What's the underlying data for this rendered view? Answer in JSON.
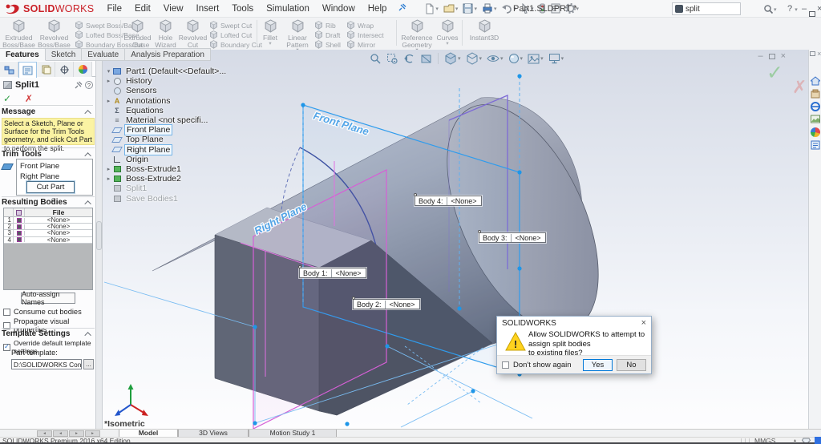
{
  "glyphs": {
    "dropdown": "▾",
    "expand": "▸",
    "expanded": "▾",
    "tab_prev": "◂",
    "tab_next": "▸",
    "close": "×",
    "minimize": "–",
    "help": "?",
    "ok_check": "✓",
    "cancel_x": "✗",
    "ellipsis": "...",
    "annotation": "A",
    "equations": "Σ",
    "material": "≡",
    "exclaim": "!",
    "units_arrow": "▴",
    "check": "✓"
  },
  "titlebar": {
    "logo_bold": "SOLID",
    "logo_light": "WORKS",
    "menus": [
      "File",
      "Edit",
      "View",
      "Insert",
      "Tools",
      "Simulation",
      "Window",
      "Help"
    ],
    "title": "Part1.SLDPRT *",
    "search_value": "split"
  },
  "ribbon": {
    "groups": [
      {
        "buttons": [
          {
            "label": "Extruded Boss/Base"
          },
          {
            "label": "Revolved Boss/Base"
          }
        ],
        "stack": [
          {
            "label": "Swept Boss/Base"
          },
          {
            "label": "Lofted Boss/Base"
          },
          {
            "label": "Boundary Boss/Base"
          }
        ]
      },
      {
        "buttons": [
          {
            "label": "Extruded Cut"
          },
          {
            "label": "Hole Wizard"
          },
          {
            "label": "Revolved Cut"
          }
        ],
        "stack": [
          {
            "label": "Swept Cut"
          },
          {
            "label": "Lofted Cut"
          },
          {
            "label": "Boundary Cut"
          }
        ]
      },
      {
        "buttons": [
          {
            "label": "Fillet"
          },
          {
            "label": "Linear Pattern"
          }
        ],
        "stack": [
          {
            "label": "Rib"
          },
          {
            "label": "Draft"
          },
          {
            "label": "Shell"
          }
        ],
        "stack2": [
          {
            "label": "Wrap"
          },
          {
            "label": "Intersect"
          },
          {
            "label": "Mirror"
          }
        ]
      },
      {
        "buttons": [
          {
            "label": "Reference Geometry"
          },
          {
            "label": "Curves"
          }
        ]
      },
      {
        "buttons": [
          {
            "label": "Instant3D"
          }
        ]
      }
    ]
  },
  "command_tabs": [
    {
      "label": "Features"
    },
    {
      "label": "Sketch"
    },
    {
      "label": "Evaluate"
    },
    {
      "label": "Analysis Preparation"
    }
  ],
  "property_manager": {
    "title": "Split1",
    "message_header": "Message",
    "message_text": "Select a Sketch, Plane or Surface for the Trim Tools geometry, and click Cut Part to perform the split.",
    "trim_header": "Trim Tools",
    "trim_selection_1": "Front Plane",
    "trim_selection_2": "Right Plane",
    "cut_part_label": "Cut Part",
    "resulting_header": "Resulting Bodies",
    "file_header": "File",
    "rows": [
      {
        "index": "1",
        "file": "<None>"
      },
      {
        "index": "2",
        "file": "<None>"
      },
      {
        "index": "3",
        "file": "<None>"
      },
      {
        "index": "4",
        "file": "<None>"
      }
    ],
    "auto_assign_label": "Auto-assign Names",
    "consume_label": "Consume cut bodies",
    "propagate_label": "Propagate visual properties",
    "template_header": "Template Settings",
    "override_label": "Override default template settings",
    "part_template_label": "Part template:",
    "template_path": "D:\\SOLIDWORKS Content\\SOLI",
    "browse_label": "..."
  },
  "feature_tree": {
    "items": [
      {
        "label": "Part1 (Default<<Default>..."
      },
      {
        "label": "History"
      },
      {
        "label": "Sensors"
      },
      {
        "label": "Annotations"
      },
      {
        "label": "Equations"
      },
      {
        "label": "Material <not specifi..."
      },
      {
        "label": "Front Plane"
      },
      {
        "label": "Top Plane"
      },
      {
        "label": "Right Plane"
      },
      {
        "label": "Origin"
      },
      {
        "label": "Boss-Extrude1"
      },
      {
        "label": "Boss-Extrude2"
      },
      {
        "label": "Split1"
      },
      {
        "label": "Save Bodies1"
      }
    ]
  },
  "viewport": {
    "plane_labels": {
      "front": "Front Plane",
      "right": "Right Plane"
    },
    "view_label": "*Isometric",
    "callouts": [
      {
        "name": "Body 1:",
        "value": "<None>"
      },
      {
        "name": "Body 2:",
        "value": "<None>"
      },
      {
        "name": "Body 3:",
        "value": "<None>"
      },
      {
        "name": "Body 4:",
        "value": "<None>"
      }
    ]
  },
  "dialog": {
    "title": "SOLIDWORKS",
    "message_line1": "Allow SOLIDWORKS to attempt to assign split bodies",
    "message_line2": "to existing files?",
    "dont_show": "Don't show again",
    "yes": "Yes",
    "no": "No"
  },
  "bottom": {
    "tabs": [
      {
        "label": "Model"
      },
      {
        "label": "3D Views"
      },
      {
        "label": "Motion Study 1"
      }
    ]
  },
  "status": {
    "left": "SOLIDWORKS Premium 2016 x64 Edition",
    "units": "MMGS"
  },
  "colors": {
    "selection_blue": "#2b9bed",
    "plane_magenta": "#d65fd6",
    "logo_red": "#ca2128",
    "message_yellow": "#fbf3a3",
    "warning_yellow": "#ffd21e"
  }
}
